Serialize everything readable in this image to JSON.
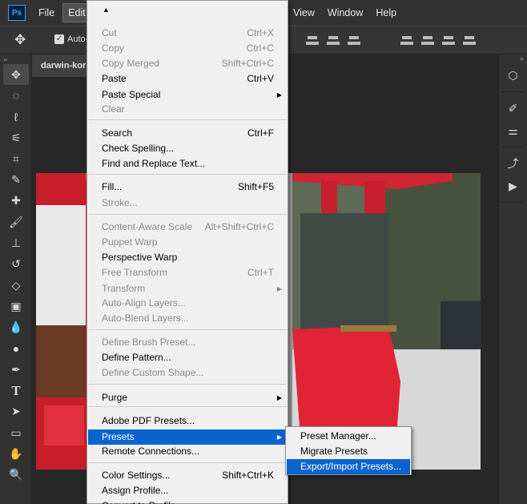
{
  "app": {
    "logo": "Ps"
  },
  "menubar": {
    "left": [
      "File",
      "Edit"
    ],
    "right": [
      "View",
      "Window",
      "Help"
    ]
  },
  "options": {
    "auto_select_label": "Auto-"
  },
  "document": {
    "tab_title": "darwin-kor"
  },
  "toolbar_icons": [
    "move-icon",
    "marquee-icon",
    "lasso-icon",
    "quick-select-icon",
    "crop-icon",
    "eyedropper-icon",
    "healing-icon",
    "brush-icon",
    "stamp-icon",
    "history-brush-icon",
    "eraser-icon",
    "gradient-icon",
    "blur-icon",
    "dodge-icon",
    "pen-icon",
    "type-icon",
    "path-select-icon",
    "rectangle-icon",
    "hand-icon",
    "zoom-icon"
  ],
  "edit_menu": {
    "items": [
      {
        "label": "Cut",
        "shortcut": "Ctrl+X",
        "enabled": false
      },
      {
        "label": "Copy",
        "shortcut": "Ctrl+C",
        "enabled": false
      },
      {
        "label": "Copy Merged",
        "shortcut": "Shift+Ctrl+C",
        "enabled": false
      },
      {
        "label": "Paste",
        "shortcut": "Ctrl+V",
        "enabled": true
      },
      {
        "label": "Paste Special",
        "shortcut": "",
        "enabled": true,
        "submenu": true
      },
      {
        "label": "Clear",
        "shortcut": "",
        "enabled": false
      },
      {
        "label": "Search",
        "shortcut": "Ctrl+F",
        "enabled": true
      },
      {
        "label": "Check Spelling...",
        "shortcut": "",
        "enabled": true
      },
      {
        "label": "Find and Replace Text...",
        "shortcut": "",
        "enabled": true
      },
      {
        "label": "Fill...",
        "shortcut": "Shift+F5",
        "enabled": true
      },
      {
        "label": "Stroke...",
        "shortcut": "",
        "enabled": false
      },
      {
        "label": "Content-Aware Scale",
        "shortcut": "Alt+Shift+Ctrl+C",
        "enabled": false
      },
      {
        "label": "Puppet Warp",
        "shortcut": "",
        "enabled": false
      },
      {
        "label": "Perspective Warp",
        "shortcut": "",
        "enabled": true
      },
      {
        "label": "Free Transform",
        "shortcut": "Ctrl+T",
        "enabled": false
      },
      {
        "label": "Transform",
        "shortcut": "",
        "enabled": false,
        "submenu": true
      },
      {
        "label": "Auto-Align Layers...",
        "shortcut": "",
        "enabled": false
      },
      {
        "label": "Auto-Blend Layers...",
        "shortcut": "",
        "enabled": false
      },
      {
        "label": "Define Brush Preset...",
        "shortcut": "",
        "enabled": false
      },
      {
        "label": "Define Pattern...",
        "shortcut": "",
        "enabled": true
      },
      {
        "label": "Define Custom Shape...",
        "shortcut": "",
        "enabled": false
      },
      {
        "label": "Purge",
        "shortcut": "",
        "enabled": true,
        "submenu": true
      },
      {
        "label": "Adobe PDF Presets...",
        "shortcut": "",
        "enabled": true
      },
      {
        "label": "Presets",
        "shortcut": "",
        "enabled": true,
        "submenu": true,
        "highlighted": true
      },
      {
        "label": "Remote Connections...",
        "shortcut": "",
        "enabled": true
      },
      {
        "label": "Color Settings...",
        "shortcut": "Shift+Ctrl+K",
        "enabled": true
      },
      {
        "label": "Assign Profile...",
        "shortcut": "",
        "enabled": true
      },
      {
        "label": "Convert to Profile...",
        "shortcut": "",
        "enabled": true
      }
    ]
  },
  "presets_submenu": {
    "items": [
      {
        "label": "Preset Manager..."
      },
      {
        "label": "Migrate Presets"
      },
      {
        "label": "Export/Import Presets...",
        "highlighted": true
      }
    ]
  },
  "colors": {
    "highlight": "#0a64ce",
    "menu_bg": "#f0f0f0",
    "app_bg": "#323232"
  }
}
